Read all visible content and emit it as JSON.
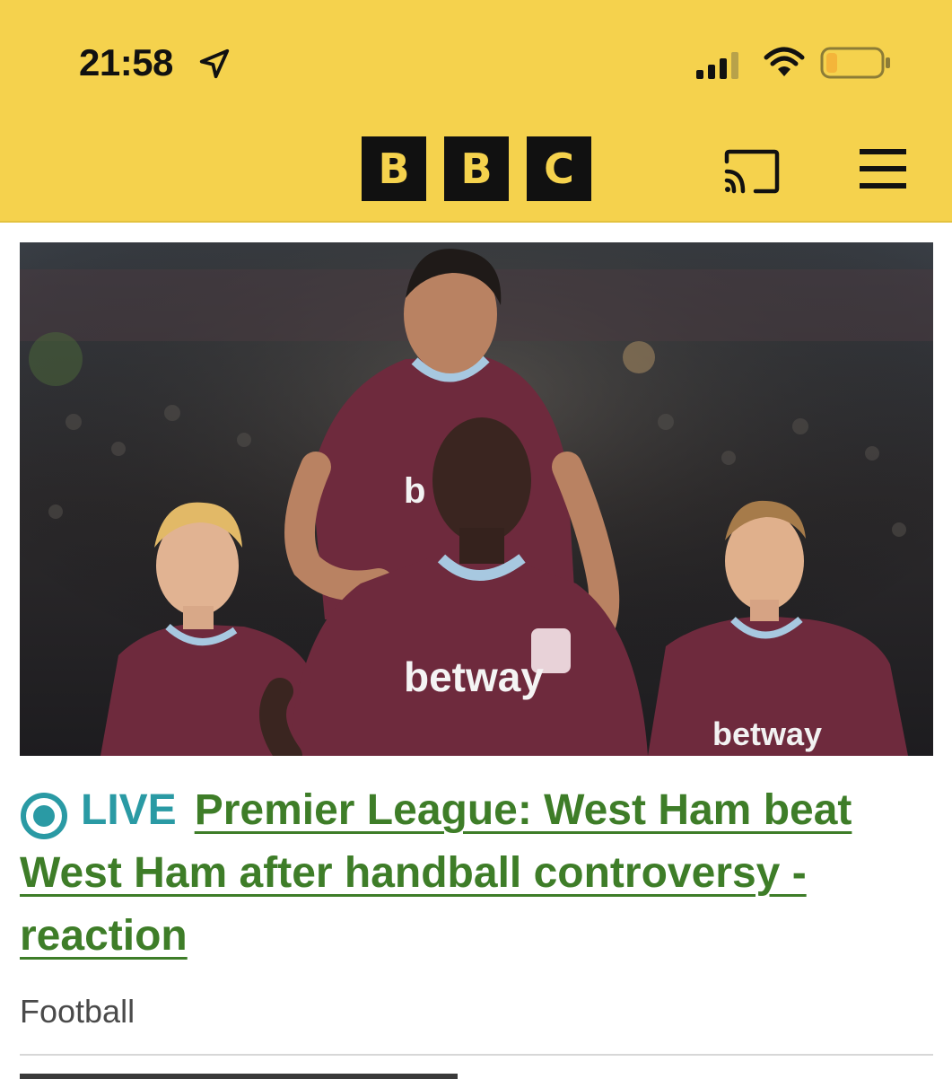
{
  "status_bar": {
    "time": "21:58",
    "location_icon": "location-arrow-icon",
    "signal_icon": "cellular-signal-icon",
    "wifi_icon": "wifi-icon",
    "battery_icon": "battery-icon",
    "battery_level": 0.2
  },
  "header": {
    "logo_letters": [
      "B",
      "B",
      "C"
    ],
    "cast_icon": "cast-icon",
    "menu_icon": "hamburger-menu-icon"
  },
  "article": {
    "image_alt": "West Ham players celebrating",
    "live_label": "LIVE",
    "live_icon": "live-indicator-icon",
    "headline": "Premier League: West Ham beat West Ham after handball controversy - reaction",
    "topic": "Football"
  },
  "colors": {
    "bbc_yellow": "#f5d24d",
    "headline_green": "#3e7d28",
    "live_teal": "#2a9aa4"
  }
}
